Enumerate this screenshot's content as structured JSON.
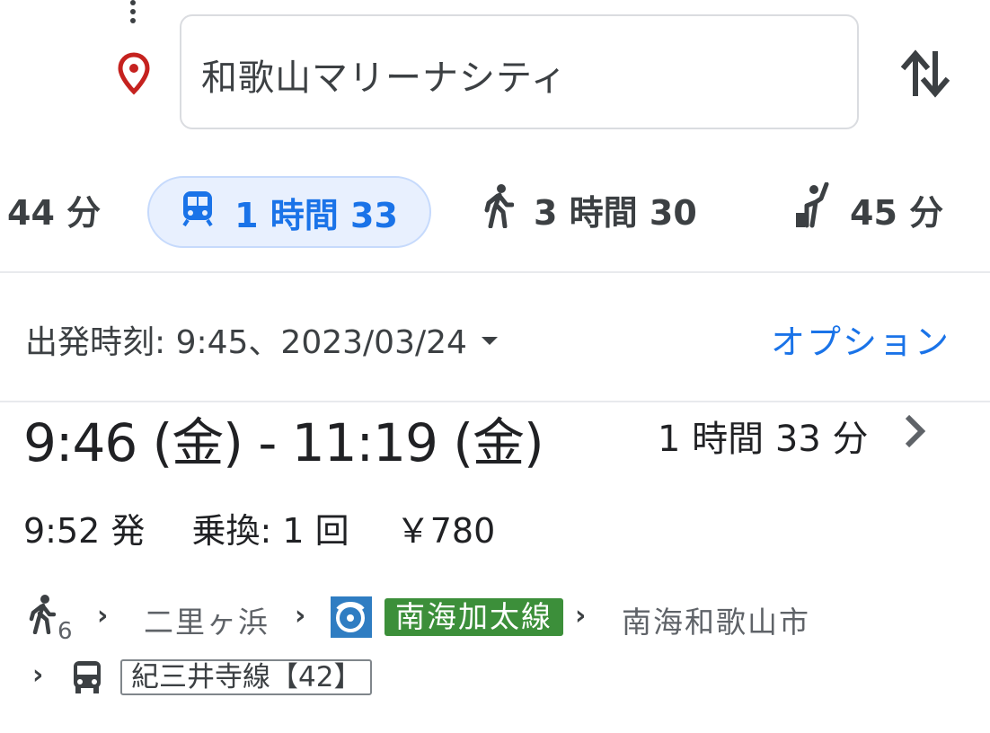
{
  "search": {
    "destination": "和歌山マリーナシティ"
  },
  "modes": {
    "drive": "44 分",
    "transit": "1 時間 33",
    "walk": "3 時間 30",
    "ride": "45 分"
  },
  "departure": {
    "label": "出発時刻: 9:45、2023/03/24",
    "options": "オプション"
  },
  "route": {
    "time_range": "9:46 (金) - 11:19 (金)",
    "duration": "1 時間 33 分",
    "depart_time": "9:52 発",
    "transfers": "乗換: 1 回",
    "fare": "￥780",
    "walk_minutes": "6",
    "stop_1": "二里ヶ浜",
    "rail_line": "南海加太線",
    "stop_2": "南海和歌山市",
    "bus_line": "紀三井寺線【42】"
  },
  "colors": {
    "accent": "#1a73e8",
    "tab_bg": "#e8f0fe",
    "rail_badge": "#3c8f3a",
    "pin": "#c5221f"
  },
  "icons": [
    "more-vert-icon",
    "place-pin-icon",
    "swap-vert-icon",
    "train-icon",
    "walk-icon",
    "hail-icon",
    "chevron-right-icon",
    "railway-logo-icon",
    "bus-icon"
  ]
}
